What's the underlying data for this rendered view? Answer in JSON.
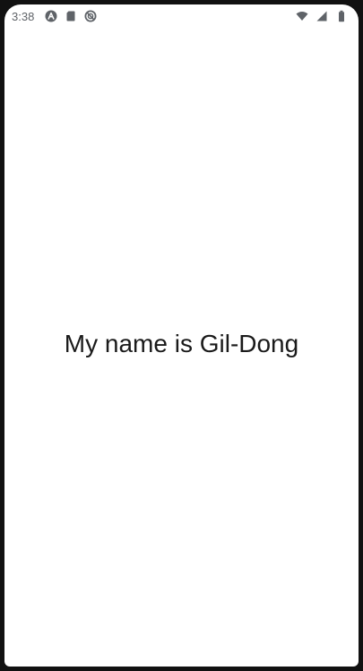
{
  "status_bar": {
    "time": "3:38",
    "left_icons": [
      "android-auto-icon",
      "sd-card-icon",
      "do-not-disturb-icon"
    ],
    "right_icons": [
      "wifi-icon",
      "cellular-signal-icon",
      "battery-icon"
    ],
    "icon_color": "#5f6368"
  },
  "main": {
    "greeting": "My name is Gil-Dong"
  },
  "colors": {
    "background": "#ffffff",
    "frame": "#111111",
    "text": "#1a1a1a"
  }
}
